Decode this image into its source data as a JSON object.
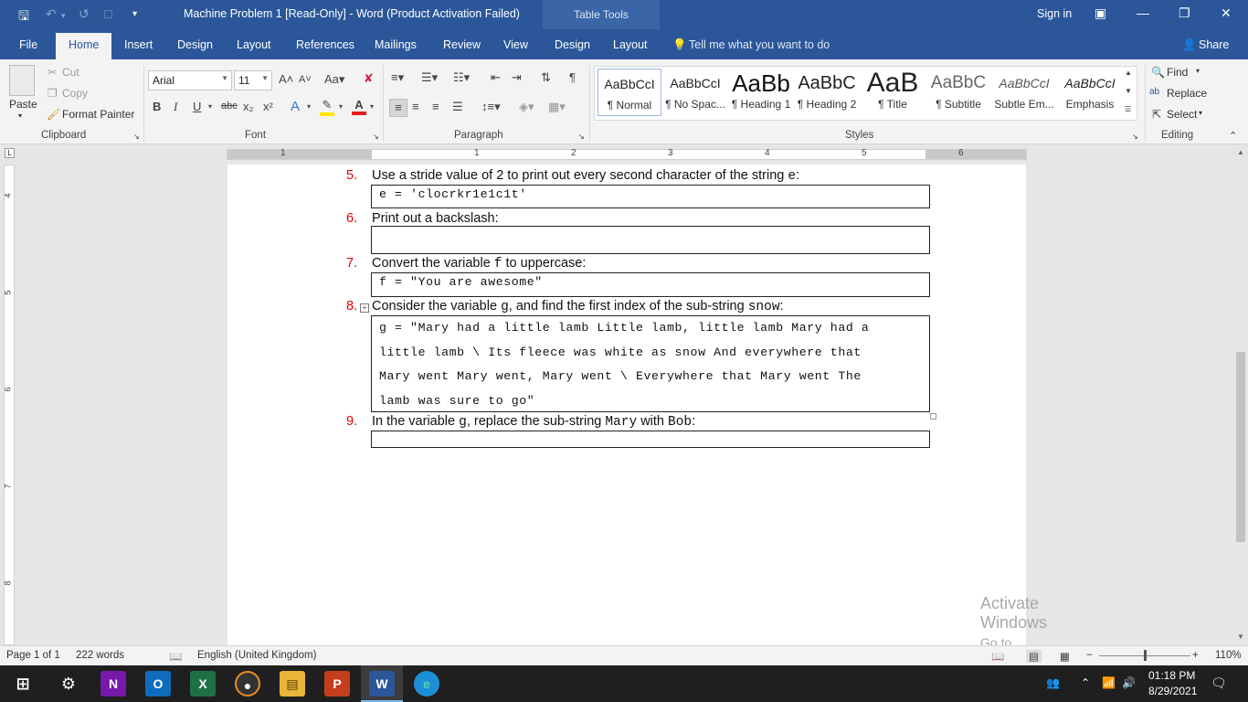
{
  "window": {
    "title": "Machine Problem 1 [Read-Only] - Word (Product Activation Failed)",
    "context_tab": "Table Tools",
    "sign_in": "Sign in"
  },
  "ribbon_tabs": [
    "File",
    "Home",
    "Insert",
    "Design",
    "Layout",
    "References",
    "Mailings",
    "Review",
    "View",
    "Design",
    "Layout"
  ],
  "tell_me": "Tell me what you want to do",
  "share": "Share",
  "clipboard": {
    "paste": "Paste",
    "cut": "Cut",
    "copy": "Copy",
    "format_painter": "Format Painter",
    "label": "Clipboard"
  },
  "font": {
    "family": "Arial",
    "size": "11",
    "label": "Font",
    "bold": "B",
    "italic": "I",
    "underline": "U",
    "strike": "abc"
  },
  "paragraph": {
    "label": "Paragraph"
  },
  "styles": {
    "label": "Styles",
    "items": [
      {
        "preview": "AaBbCcI",
        "name": "¶ Normal"
      },
      {
        "preview": "AaBbCcI",
        "name": "¶ No Spac..."
      },
      {
        "preview": "AaBb",
        "name": "¶ Heading 1"
      },
      {
        "preview": "AaBbC",
        "name": "¶ Heading 2"
      },
      {
        "preview": "AaB",
        "name": "¶ Title"
      },
      {
        "preview": "AaBbC",
        "name": "¶ Subtitle"
      },
      {
        "preview": "AaBbCcI",
        "name": "Subtle Em..."
      },
      {
        "preview": "AaBbCcI",
        "name": "Emphasis"
      }
    ]
  },
  "editing": {
    "find": "Find",
    "replace": "Replace",
    "select": "Select",
    "label": "Editing"
  },
  "ruler_numbers": [
    "1",
    "2",
    "1",
    "2",
    "3",
    "4",
    "5",
    "6"
  ],
  "vruler_numbers": [
    "4",
    "5",
    "6",
    "7",
    "8"
  ],
  "document": {
    "q5": {
      "num": "5.",
      "text": "Use a stride value of 2 to print out every second character of the string ",
      "code": "e",
      "tail": ":",
      "box": "e = 'clocrkr1e1c1t'"
    },
    "q6": {
      "num": "6.",
      "text": "Print out a backslash:"
    },
    "q7": {
      "num": "7.",
      "text": "Convert the variable ",
      "code": "f",
      "tail": " to uppercase:",
      "box": "f = \"You are awesome\""
    },
    "q8": {
      "num": "8.",
      "text": "Consider the variable ",
      "code": "g",
      "mid": ", and find the first index of the sub-string ",
      "code2": "snow",
      "tail": ":",
      "box_lines": [
        "g = \"Mary had a little lamb Little lamb, little lamb Mary had a",
        "little lamb \\ Its fleece was white as snow And everywhere that",
        "Mary went Mary went, Mary went \\ Everywhere that Mary went The",
        "lamb was sure to go\""
      ]
    },
    "q9": {
      "num": "9.",
      "text": "In the variable ",
      "code": "g",
      "mid": ", replace the sub-string ",
      "code2": "Mary",
      "mid2": " with ",
      "code3": "Bob",
      "tail": ":"
    }
  },
  "activate": {
    "line1": "Activate Windows",
    "line2": "Go to Settings to activate Windows."
  },
  "status": {
    "page": "Page 1 of 1",
    "words": "222 words",
    "language": "English (United Kingdom)",
    "zoom": "110%"
  },
  "taskbar": {
    "time": "01:18 PM",
    "date": "8/29/2021"
  },
  "colors": {
    "word_blue": "#2b579a",
    "question_number_red": "#e00000"
  }
}
